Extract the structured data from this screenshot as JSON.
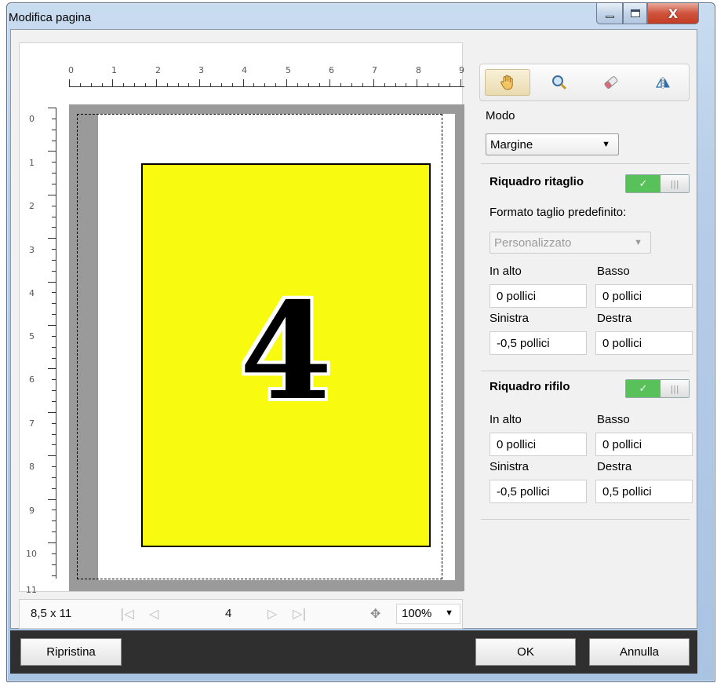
{
  "window": {
    "title": "Modifica pagina",
    "controls": {
      "minimize": "minimize-icon",
      "maximize": "maximize-icon",
      "close_glyph": "X"
    }
  },
  "preview": {
    "ruler_h": [
      "0",
      "1",
      "2",
      "3",
      "4",
      "5",
      "6",
      "7",
      "8",
      "9"
    ],
    "ruler_v": [
      "0",
      "1",
      "2",
      "3",
      "4",
      "5",
      "6",
      "7",
      "8",
      "9",
      "10",
      "11"
    ],
    "page_number_shown": "4",
    "page_color": "#f8fa10"
  },
  "navigation": {
    "page_size": "8,5 x 11",
    "current_page": "4",
    "zoom": "100%",
    "icons": [
      "first-page-icon",
      "prev-page-icon",
      "next-page-icon",
      "last-page-icon",
      "pan-icon"
    ]
  },
  "toolbar": {
    "tools": [
      "hand-tool-icon",
      "zoom-tool-icon",
      "eraser-tool-icon",
      "flip-tool-icon"
    ],
    "selected": "hand-tool-icon"
  },
  "mode": {
    "label": "Modo",
    "value": "Margine"
  },
  "crop_box": {
    "title": "Riquadro ritaglio",
    "enabled": true,
    "preset_label": "Formato taglio predefinito:",
    "preset_value": "Personalizzato",
    "top_label": "In alto",
    "top_value": "0 pollici",
    "bottom_label": "Basso",
    "bottom_value": "0 pollici",
    "left_label": "Sinistra",
    "left_value": "-0,5 pollici",
    "right_label": "Destra",
    "right_value": "0 pollici"
  },
  "trim_box": {
    "title": "Riquadro rifilo",
    "enabled": true,
    "top_label": "In alto",
    "top_value": "0 pollici",
    "bottom_label": "Basso",
    "bottom_value": "0 pollici",
    "left_label": "Sinistra",
    "left_value": "-0,5 pollici",
    "right_label": "Destra",
    "right_value": "0,5 pollici"
  },
  "toggle": {
    "on_glyph": "✓",
    "off_glyph": "|||"
  },
  "buttons": {
    "reset": "Ripristina",
    "ok": "OK",
    "cancel": "Annulla"
  }
}
